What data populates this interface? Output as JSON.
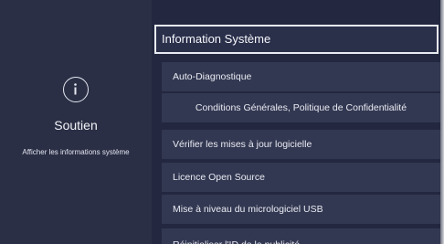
{
  "support_panel": {
    "icon": "info-circle-icon",
    "title": "Soutien",
    "description": "Afficher les informations système"
  },
  "menu": {
    "header": "Information Système",
    "items": [
      {
        "label": "Auto-Diagnostique"
      },
      {
        "label": "Conditions Générales, Politique de Confidentialité"
      },
      {
        "label": "Vérifier les mises à jour logicielle"
      },
      {
        "label": "Licence Open Source"
      },
      {
        "label": "Mise à niveau du micrologiciel USB"
      },
      {
        "label": "Réinitialiser l'ID de la publicité"
      }
    ]
  },
  "colors": {
    "background": "#252a40",
    "left_panel": "#2a2f46",
    "menu_item": "#333852",
    "focus_border": "#e9ebf3",
    "text": "#e9ebf2"
  }
}
